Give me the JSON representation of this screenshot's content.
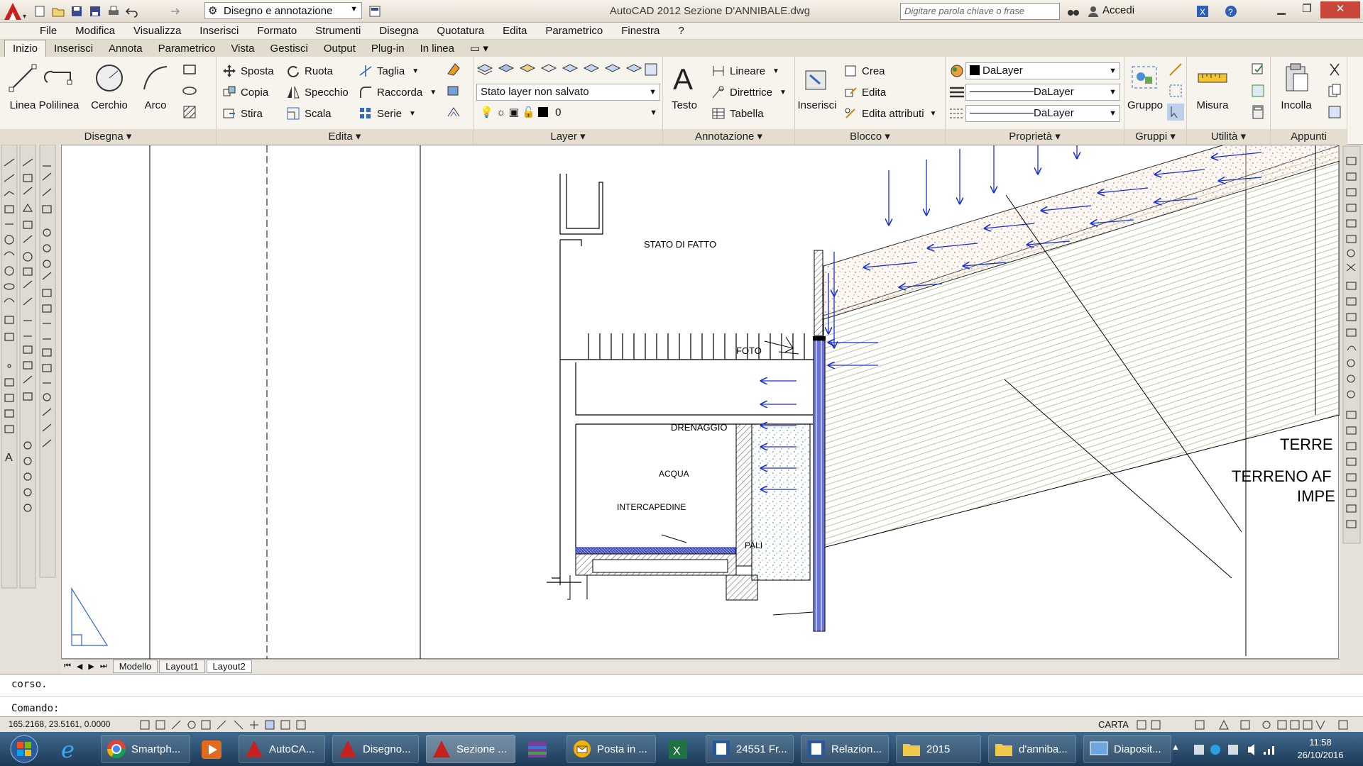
{
  "titlebar": {
    "workspace": "Disegno e annotazione",
    "title": "AutoCAD 2012   Sezione D'ANNIBALE.dwg",
    "search_placeholder": "Digitare parola chiave o frase",
    "login": "Accedi"
  },
  "menubar": [
    "File",
    "Modifica",
    "Visualizza",
    "Inserisci",
    "Formato",
    "Strumenti",
    "Disegna",
    "Quotatura",
    "Edita",
    "Parametrico",
    "Finestra",
    "?"
  ],
  "ribbon_tabs": [
    "Inizio",
    "Inserisci",
    "Annota",
    "Parametrico",
    "Vista",
    "Gestisci",
    "Output",
    "Plug-in",
    "In linea"
  ],
  "ribbon": {
    "disegna": {
      "title": "Disegna",
      "linea": "Linea",
      "polilinea": "Polilinea",
      "cerchio": "Cerchio",
      "arco": "Arco"
    },
    "edita": {
      "title": "Edita",
      "sposta": "Sposta",
      "ruota": "Ruota",
      "taglia": "Taglia",
      "copia": "Copia",
      "specchio": "Specchio",
      "raccorda": "Raccorda",
      "stira": "Stira",
      "scala": "Scala",
      "serie": "Serie"
    },
    "layer": {
      "title": "Layer",
      "state": "Stato layer non salvato",
      "current": "0"
    },
    "annotazione": {
      "title": "Annotazione",
      "testo": "Testo",
      "lineare": "Lineare",
      "direttrice": "Direttrice",
      "tabella": "Tabella"
    },
    "blocco": {
      "title": "Blocco",
      "inserisci": "Inserisci",
      "crea": "Crea",
      "edita": "Edita",
      "edita_attributi": "Edita attributi"
    },
    "proprieta": {
      "title": "Proprietà",
      "color": "DaLayer",
      "linetype": "DaLayer",
      "lineweight": "DaLayer"
    },
    "gruppi": {
      "title": "Gruppi",
      "gruppo": "Gruppo"
    },
    "utilita": {
      "title": "Utilità",
      "misura": "Misura"
    },
    "appunti": {
      "title": "Appunti",
      "incolla": "Incolla"
    }
  },
  "drawing": {
    "labels": {
      "stato": "STATO DI FATTO",
      "foto": "FOTO",
      "drenaggio": "DRENAGGIO",
      "acqua": "ACQUA",
      "intercapedine": "INTERCAPEDINE",
      "pali": "PALI",
      "terre": "TERRE",
      "terreno": "TERRENO AF",
      "impe": "IMPE"
    }
  },
  "layout_tabs": [
    "Modello",
    "Layout1",
    "Layout2"
  ],
  "command": {
    "history": "corso.",
    "prompt": "Comando:"
  },
  "status": {
    "coords": "165.2168, 23.5161, 0.0000",
    "space": "CARTA"
  },
  "taskbar": {
    "tasks": [
      "Smartph...",
      "AutoCA...",
      "Disegno...",
      "Sezione ...",
      "Posta in ...",
      "24551 Fr...",
      "Relazion...",
      "2015",
      "d'anniba...",
      "Diaposit..."
    ],
    "time": "11:58",
    "date": "26/10/2016"
  },
  "colors": {
    "ribbon_bg": "#f7f4ee",
    "arrow_blue": "#1b2fd1",
    "title_bar": "#efe8dc"
  }
}
